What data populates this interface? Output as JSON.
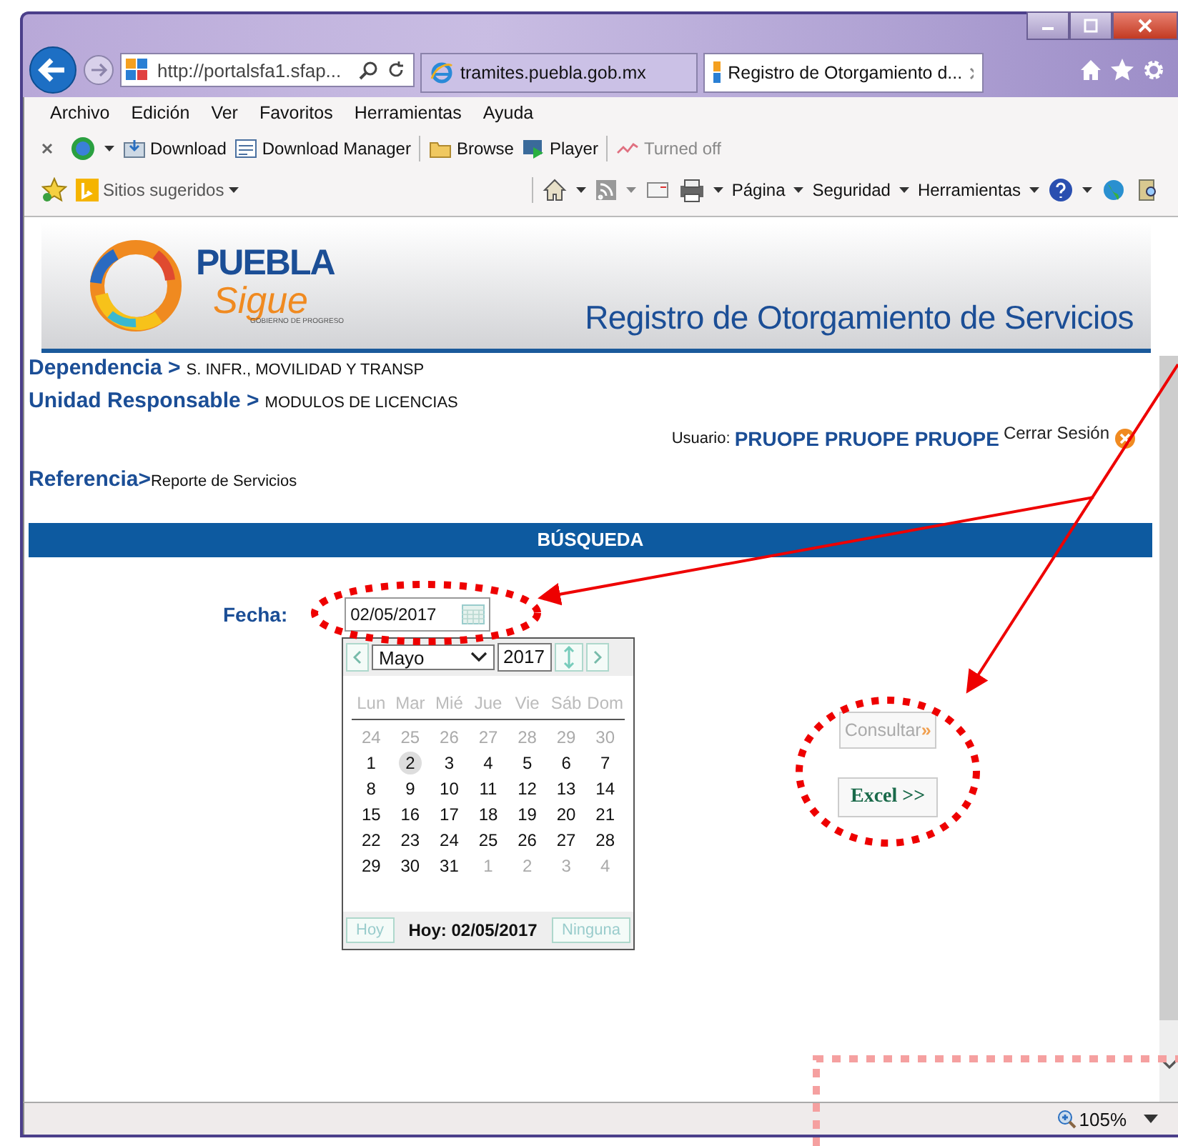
{
  "browser": {
    "address": "http://portalsfa1.sfap...",
    "tabs": [
      {
        "title": "tramites.puebla.gob.mx",
        "kind": "ie",
        "selected": false
      },
      {
        "title": "Registro de Otorgamiento d...",
        "kind": "site",
        "selected": true
      }
    ],
    "menu": [
      "Archivo",
      "Edición",
      "Ver",
      "Favoritos",
      "Herramientas",
      "Ayuda"
    ],
    "toolbar": [
      {
        "label": "Download",
        "kind": "download",
        "disabled": false
      },
      {
        "label": "Download Manager",
        "kind": "manager",
        "disabled": false
      },
      {
        "label": "Browse",
        "kind": "folder",
        "disabled": false
      },
      {
        "label": "Player",
        "kind": "player",
        "disabled": false
      },
      {
        "label": "Turned off",
        "kind": "off",
        "disabled": true
      }
    ],
    "favorites": "Sitios sugeridos",
    "commands": [
      "Página",
      "Seguridad",
      "Herramientas"
    ],
    "zoom": "105%"
  },
  "header": {
    "logo_top": "PUEBLA",
    "logo_bottom": "Sigue",
    "logo_tag": "GOBIERNO DE PROGRESO",
    "title": "Registro de Otorgamiento de Servicios"
  },
  "info": [
    {
      "label": "Dependencia >",
      "value": "S. INFR., MOVILIDAD Y TRANSP"
    },
    {
      "label": "Unidad Responsable >",
      "value": "MODULOS DE LICENCIAS"
    }
  ],
  "user": {
    "label": "Usuario:",
    "name": "PRUOPE PRUOPE PRUOPE",
    "logout": "Cerrar Sesión"
  },
  "reference": {
    "label": "Referencia>",
    "value": "Reporte de Servicios"
  },
  "section_title": "BÚSQUEDA",
  "date_field": {
    "label": "Fecha:",
    "value": "02/05/2017"
  },
  "calendar": {
    "month": "Mayo",
    "year": "2017",
    "weekdays": [
      "Lun",
      "Mar",
      "Mié",
      "Jue",
      "Vie",
      "Sáb",
      "Dom"
    ],
    "weeks": [
      [
        {
          "d": "24",
          "other": true,
          "selected": false
        },
        {
          "d": "25",
          "other": true,
          "selected": false
        },
        {
          "d": "26",
          "other": true,
          "selected": false
        },
        {
          "d": "27",
          "other": true,
          "selected": false
        },
        {
          "d": "28",
          "other": true,
          "selected": false
        },
        {
          "d": "29",
          "other": true,
          "selected": false
        },
        {
          "d": "30",
          "other": true,
          "selected": false
        }
      ],
      [
        {
          "d": "1",
          "other": false,
          "selected": false
        },
        {
          "d": "2",
          "other": false,
          "selected": true
        },
        {
          "d": "3",
          "other": false,
          "selected": false
        },
        {
          "d": "4",
          "other": false,
          "selected": false
        },
        {
          "d": "5",
          "other": false,
          "selected": false
        },
        {
          "d": "6",
          "other": false,
          "selected": false
        },
        {
          "d": "7",
          "other": false,
          "selected": false
        }
      ],
      [
        {
          "d": "8",
          "other": false,
          "selected": false
        },
        {
          "d": "9",
          "other": false,
          "selected": false
        },
        {
          "d": "10",
          "other": false,
          "selected": false
        },
        {
          "d": "11",
          "other": false,
          "selected": false
        },
        {
          "d": "12",
          "other": false,
          "selected": false
        },
        {
          "d": "13",
          "other": false,
          "selected": false
        },
        {
          "d": "14",
          "other": false,
          "selected": false
        }
      ],
      [
        {
          "d": "15",
          "other": false,
          "selected": false
        },
        {
          "d": "16",
          "other": false,
          "selected": false
        },
        {
          "d": "17",
          "other": false,
          "selected": false
        },
        {
          "d": "18",
          "other": false,
          "selected": false
        },
        {
          "d": "19",
          "other": false,
          "selected": false
        },
        {
          "d": "20",
          "other": false,
          "selected": false
        },
        {
          "d": "21",
          "other": false,
          "selected": false
        }
      ],
      [
        {
          "d": "22",
          "other": false,
          "selected": false
        },
        {
          "d": "23",
          "other": false,
          "selected": false
        },
        {
          "d": "24",
          "other": false,
          "selected": false
        },
        {
          "d": "25",
          "other": false,
          "selected": false
        },
        {
          "d": "26",
          "other": false,
          "selected": false
        },
        {
          "d": "27",
          "other": false,
          "selected": false
        },
        {
          "d": "28",
          "other": false,
          "selected": false
        }
      ],
      [
        {
          "d": "29",
          "other": false,
          "selected": false
        },
        {
          "d": "30",
          "other": false,
          "selected": false
        },
        {
          "d": "31",
          "other": false,
          "selected": false
        },
        {
          "d": "1",
          "other": true,
          "selected": false
        },
        {
          "d": "2",
          "other": true,
          "selected": false
        },
        {
          "d": "3",
          "other": true,
          "selected": false
        },
        {
          "d": "4",
          "other": true,
          "selected": false
        }
      ]
    ],
    "today_button": "Hoy",
    "today_text": "Hoy: 02/05/2017",
    "none_button": "Ninguna"
  },
  "buttons": [
    {
      "label": "Consultar",
      "suffix": "»",
      "disabled": true
    },
    {
      "label": "Excel >>",
      "disabled": false
    }
  ]
}
